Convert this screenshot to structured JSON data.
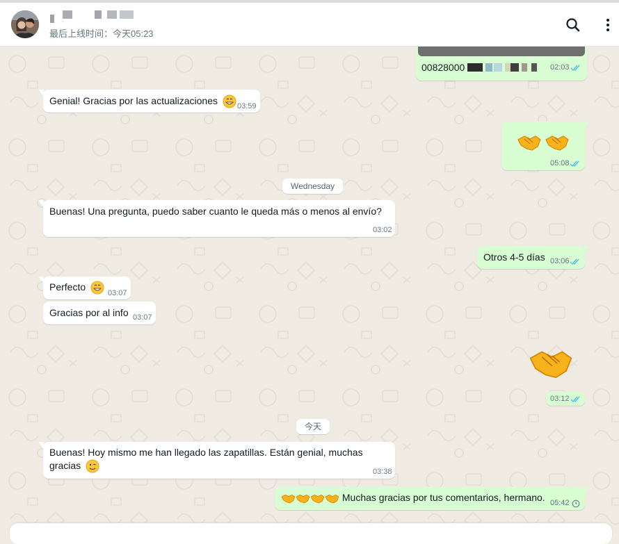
{
  "header": {
    "last_seen": "最后上线时间：今天05:23",
    "search_icon": "search-icon",
    "menu_icon": "kebab-menu-icon"
  },
  "chat": {
    "date_separators": [
      "Wednesday",
      "今天"
    ],
    "messages": [
      {
        "id": "m1",
        "direction": "out",
        "text": "00828000",
        "time": "02:03",
        "status": "read"
      },
      {
        "id": "m2",
        "direction": "in",
        "text": "Genial! Gracias por las actualizaciones",
        "time": "03:59",
        "emoji": "grin"
      },
      {
        "id": "m3",
        "direction": "out",
        "text": "",
        "time": "05:08",
        "status": "read",
        "emoji": "handshake x2"
      },
      {
        "id": "m4",
        "direction": "in",
        "text": "Buenas! Una pregunta, puedo saber cuanto le queda más o menos al envío?",
        "time": "03:02"
      },
      {
        "id": "m5",
        "direction": "out",
        "text": "Otros 4-5 días",
        "time": "03:06",
        "status": "read"
      },
      {
        "id": "m6",
        "direction": "in",
        "text": "Perfecto",
        "time": "03:07",
        "emoji": "grin"
      },
      {
        "id": "m7",
        "direction": "in",
        "text": "Gracias por al info",
        "time": "03:07"
      },
      {
        "id": "m8",
        "direction": "out",
        "text": "",
        "time": "03:12",
        "status": "read",
        "emoji": "handshake"
      },
      {
        "id": "m9",
        "direction": "in",
        "text_line1": "Buenas! Hoy mismo me han llegado las zapatillas. Están genial, muchas",
        "text_line2": "gracias",
        "time": "03:38",
        "emoji": "wink"
      },
      {
        "id": "m10",
        "direction": "out",
        "text": "Muchas gracias por tus comentarios, hermano.",
        "time": "05:42",
        "status": "pending",
        "emoji": "handshake x4"
      }
    ]
  },
  "colors": {
    "incoming": "#ffffff",
    "outgoing": "#d9fdd3",
    "read_ticks": "#53bdeb",
    "background": "#efeae2"
  }
}
